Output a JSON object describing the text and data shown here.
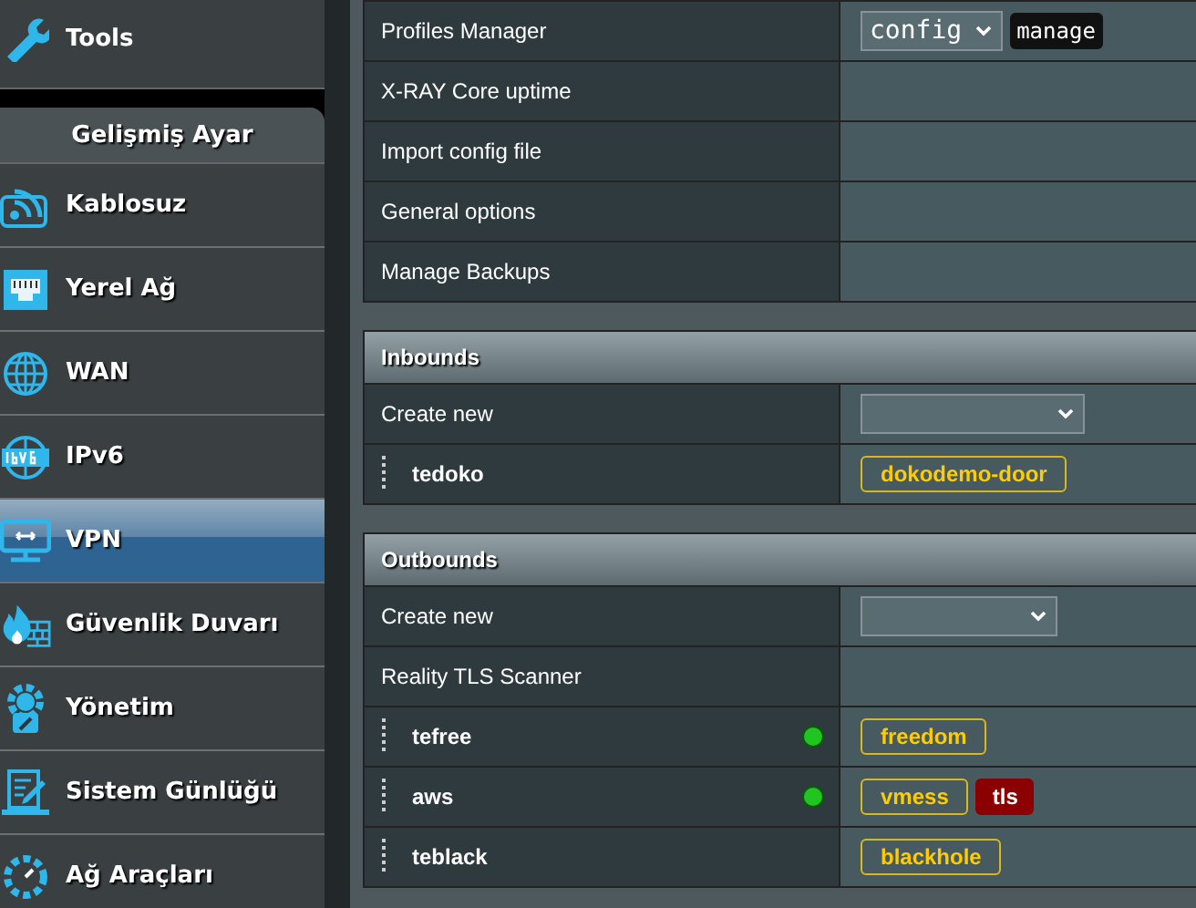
{
  "sidebar": {
    "top_item": {
      "label": "Tools"
    },
    "section_title": "Gelişmiş Ayar",
    "items": [
      {
        "label": "Kablosuz",
        "selected": false
      },
      {
        "label": "Yerel Ağ",
        "selected": false
      },
      {
        "label": "WAN",
        "selected": false
      },
      {
        "label": "IPv6",
        "selected": false
      },
      {
        "label": "VPN",
        "selected": true
      },
      {
        "label": "Güvenlik Duvarı",
        "selected": false
      },
      {
        "label": "Yönetim",
        "selected": false
      },
      {
        "label": "Sistem Günlüğü",
        "selected": false
      },
      {
        "label": "Ağ Araçları",
        "selected": false
      }
    ]
  },
  "settings": [
    {
      "label": "Profiles Manager",
      "kind": "profile",
      "value": "config",
      "button": "manage"
    },
    {
      "label": "X-RAY Core uptime",
      "kind": "empty"
    },
    {
      "label": "Import config file",
      "kind": "empty"
    },
    {
      "label": "General options",
      "kind": "empty"
    },
    {
      "label": "Manage Backups",
      "kind": "empty"
    }
  ],
  "inbounds": {
    "title": "Inbounds",
    "create_new": "Create new",
    "items": [
      {
        "name": "tedoko",
        "connected": false,
        "tags": [
          {
            "label": "dokodemo-door",
            "kind": "protocol"
          }
        ]
      }
    ]
  },
  "outbounds": {
    "title": "Outbounds",
    "create_new": "Create new",
    "scanner": "Reality TLS Scanner",
    "items": [
      {
        "name": "tefree",
        "connected": true,
        "tags": [
          {
            "label": "freedom",
            "kind": "protocol"
          }
        ]
      },
      {
        "name": "aws",
        "connected": true,
        "tags": [
          {
            "label": "vmess",
            "kind": "protocol"
          },
          {
            "label": "tls",
            "kind": "security"
          }
        ]
      },
      {
        "name": "teblack",
        "connected": false,
        "tags": [
          {
            "label": "blackhole",
            "kind": "protocol"
          }
        ]
      }
    ]
  }
}
